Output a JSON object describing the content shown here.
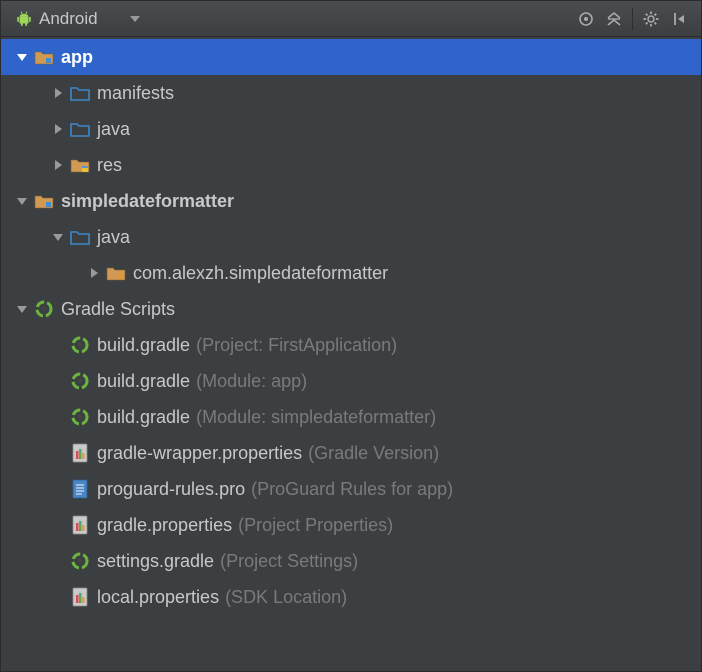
{
  "toolbar": {
    "view_label": "Android"
  },
  "tree": {
    "app": {
      "label": "app",
      "manifests": "manifests",
      "java": "java",
      "res": "res"
    },
    "sdf": {
      "label": "simpledateformatter",
      "java": "java",
      "package": "com.alexzh.simpledateformatter"
    },
    "gradle": {
      "label": "Gradle Scripts",
      "items": [
        {
          "name": "build.gradle",
          "hint": "(Project: FirstApplication)",
          "icon": "gradle"
        },
        {
          "name": "build.gradle",
          "hint": "(Module: app)",
          "icon": "gradle"
        },
        {
          "name": "build.gradle",
          "hint": "(Module: simpledateformatter)",
          "icon": "gradle"
        },
        {
          "name": "gradle-wrapper.properties",
          "hint": "(Gradle Version)",
          "icon": "props"
        },
        {
          "name": "proguard-rules.pro",
          "hint": "(ProGuard Rules for app)",
          "icon": "textfile"
        },
        {
          "name": "gradle.properties",
          "hint": "(Project Properties)",
          "icon": "props"
        },
        {
          "name": "settings.gradle",
          "hint": "(Project Settings)",
          "icon": "gradle"
        },
        {
          "name": "local.properties",
          "hint": "(SDK Location)",
          "icon": "props"
        }
      ]
    }
  }
}
